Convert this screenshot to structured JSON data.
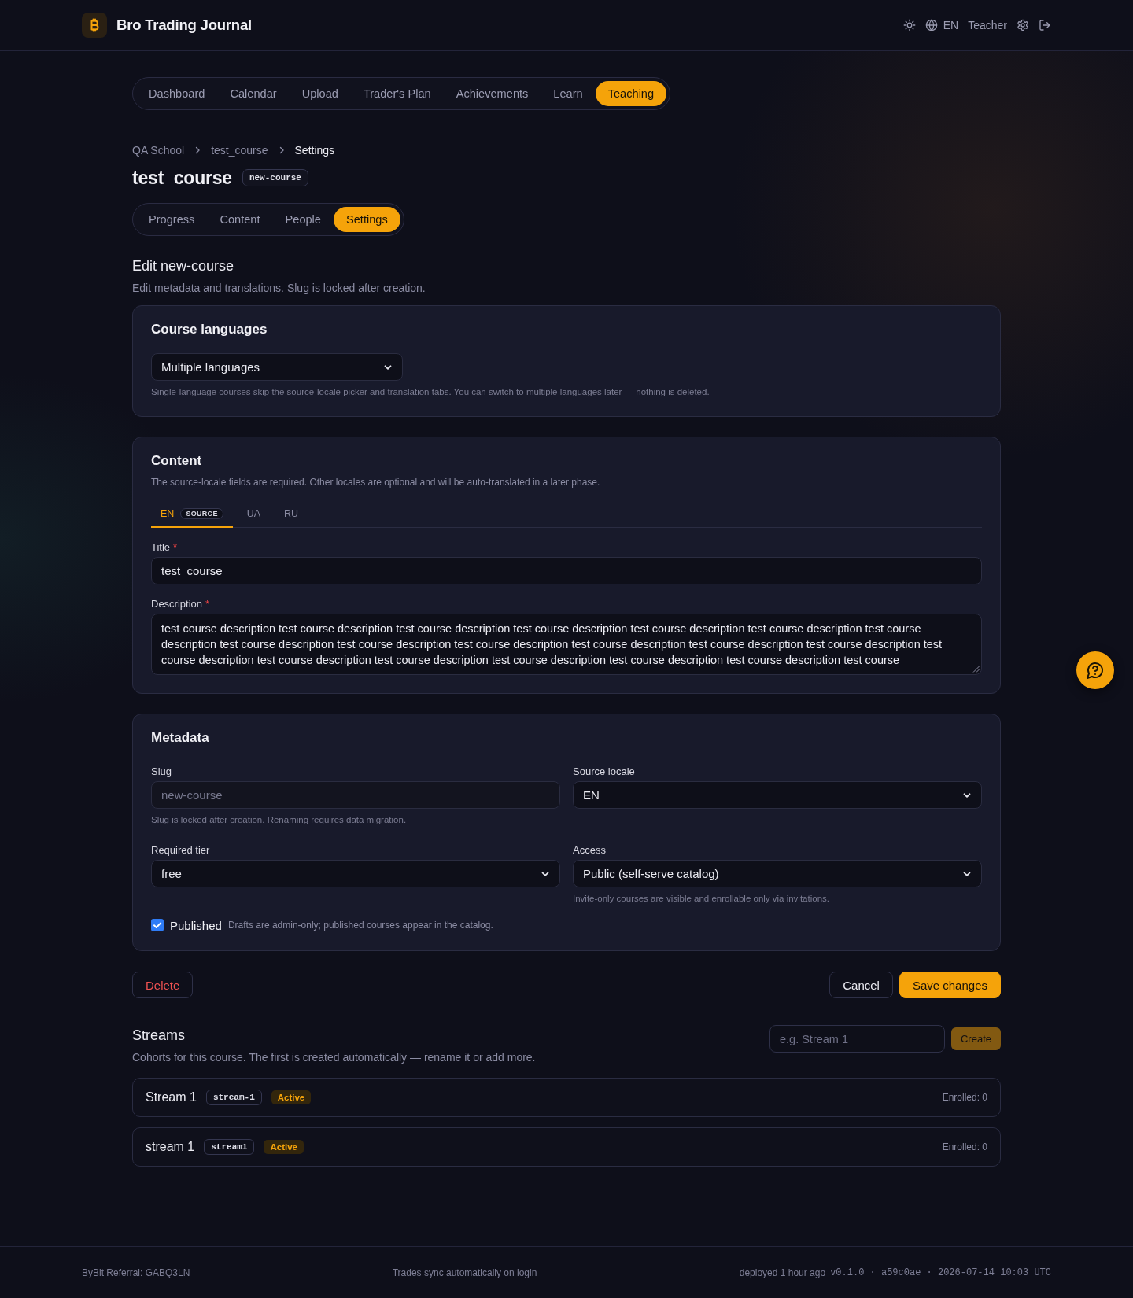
{
  "header": {
    "brand": "Bro Trading Journal",
    "language": "EN",
    "role": "Teacher"
  },
  "nav": [
    {
      "label": "Dashboard",
      "selected": false
    },
    {
      "label": "Calendar",
      "selected": false
    },
    {
      "label": "Upload",
      "selected": false
    },
    {
      "label": "Trader's Plan",
      "selected": false
    },
    {
      "label": "Achievements",
      "selected": false
    },
    {
      "label": "Learn",
      "selected": false
    },
    {
      "label": "Teaching",
      "selected": true
    }
  ],
  "breadcrumb": [
    "QA School",
    "test_course",
    "Settings"
  ],
  "course": {
    "title": "test_course",
    "slug": "new-course"
  },
  "course_tabs": [
    {
      "label": "Progress",
      "selected": false
    },
    {
      "label": "Content",
      "selected": false
    },
    {
      "label": "People",
      "selected": false
    },
    {
      "label": "Settings",
      "selected": true
    }
  ],
  "edit": {
    "title": "Edit new-course",
    "subtitle": "Edit metadata and translations. Slug is locked after creation."
  },
  "course_languages": {
    "title": "Course languages",
    "field": {
      "kind": "select",
      "value": "Multiple languages",
      "help": "Single-language courses skip the source-locale picker and translation tabs. You can switch to multiple languages later — nothing is deleted."
    }
  },
  "content": {
    "title": "Content",
    "subtitle": "The source-locale fields are required. Other locales are optional and will be auto-translated in a later phase.",
    "locale_tabs": [
      {
        "label": "EN",
        "badge": "SOURCE",
        "selected": true
      },
      {
        "label": "UA",
        "selected": false
      },
      {
        "label": "RU",
        "selected": false
      }
    ],
    "fields": [
      {
        "kind": "input",
        "label": "Title",
        "required_mark": "*",
        "value": "test_course"
      },
      {
        "kind": "textarea",
        "label": "Description",
        "required_mark": "*",
        "value": "test course description test course description test course description test course description test course description test course description test course description test course description test course description test course description test course description test course description test course description test course description test course description test course description test course description test course description test course description test course"
      }
    ]
  },
  "metadata": {
    "title": "Metadata",
    "fields": [
      {
        "kind": "input",
        "label": "Slug",
        "value": "new-course",
        "disabled": true,
        "help": "Slug is locked after creation. Renaming requires data migration."
      },
      {
        "kind": "select",
        "label": "Source locale",
        "value": "EN",
        "disabled": false
      },
      {
        "kind": "select",
        "label": "Required tier",
        "value": "free",
        "disabled": false
      },
      {
        "kind": "select",
        "label": "Access",
        "value": "Public (self-serve catalog)",
        "disabled": false,
        "help": "Invite-only courses are visible and enrollable only via invitations."
      }
    ],
    "published": {
      "label": "Published",
      "checked": true,
      "hint": "Drafts are admin-only; published courses appear in the catalog."
    }
  },
  "actions": [
    {
      "kind": "danger",
      "label": "Delete"
    },
    {
      "kind": "secondary",
      "label": "Cancel"
    },
    {
      "kind": "primary",
      "label": "Save changes"
    }
  ],
  "streams": {
    "title": "Streams",
    "subtitle": "Cohorts for this course. The first is created automatically — rename it or add more.",
    "new_stream": {
      "placeholder": "e.g. Stream 1"
    },
    "create": {
      "label": "Create",
      "disabled": true
    },
    "rows": [
      {
        "name": "Stream 1",
        "slug": "stream-1",
        "status": "Active",
        "enrolled": "Enrolled: 0"
      },
      {
        "name": "stream 1",
        "slug": "stream1",
        "status": "Active",
        "enrolled": "Enrolled: 0"
      }
    ]
  },
  "footer": {
    "referral": "ByBit Referral: GABQ3LN",
    "sync": "Trades sync automatically on login",
    "deployed": "deployed 1 hour ago",
    "build": "v0.1.0 · a59c0ae · 2026-07-14 10:03 UTC"
  }
}
